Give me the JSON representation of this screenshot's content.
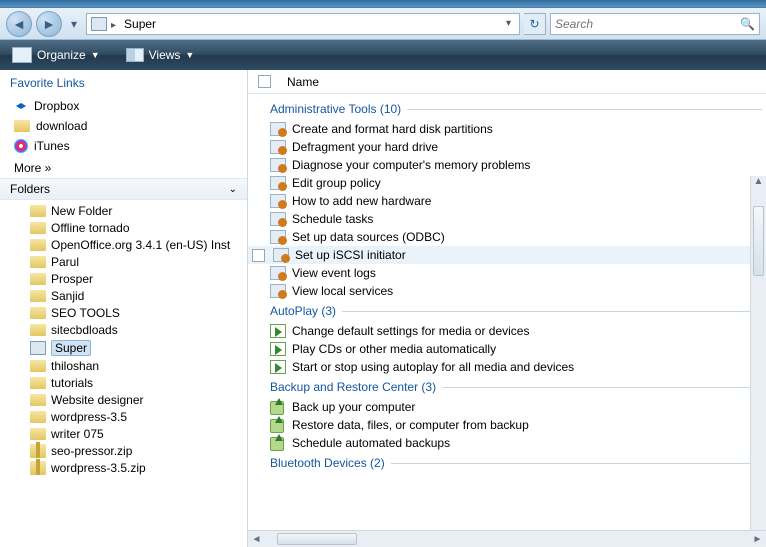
{
  "address": {
    "current": "Super"
  },
  "search": {
    "placeholder": "Search"
  },
  "toolbar": {
    "organize": "Organize",
    "views": "Views"
  },
  "sidebar": {
    "favorites_header": "Favorite Links",
    "favorites": [
      {
        "label": "Dropbox",
        "icon": "dropbox"
      },
      {
        "label": "download",
        "icon": "folder"
      },
      {
        "label": "iTunes",
        "icon": "itunes"
      }
    ],
    "more": "More »",
    "folders_header": "Folders",
    "tree": [
      {
        "label": "New Folder",
        "icon": "folder"
      },
      {
        "label": "Offline tornado",
        "icon": "folder"
      },
      {
        "label": "OpenOffice.org 3.4.1 (en-US) Inst",
        "icon": "folder"
      },
      {
        "label": "Parul",
        "icon": "folder"
      },
      {
        "label": "Prosper",
        "icon": "folder"
      },
      {
        "label": "Sanjid",
        "icon": "folder"
      },
      {
        "label": "SEO TOOLS",
        "icon": "folder"
      },
      {
        "label": "sitecbdloads",
        "icon": "folder"
      },
      {
        "label": "Super",
        "icon": "super",
        "selected": true
      },
      {
        "label": "thiloshan",
        "icon": "folder"
      },
      {
        "label": "tutorials",
        "icon": "folder"
      },
      {
        "label": "Website designer",
        "icon": "folder"
      },
      {
        "label": "wordpress-3.5",
        "icon": "folder"
      },
      {
        "label": "writer 075",
        "icon": "folder"
      },
      {
        "label": "seo-pressor.zip",
        "icon": "zip"
      },
      {
        "label": "wordpress-3.5.zip",
        "icon": "zip"
      }
    ]
  },
  "columns": {
    "name": "Name"
  },
  "groups": [
    {
      "title": "Administrative Tools (10)",
      "icon": "admin",
      "items": [
        {
          "label": "Create and format hard disk partitions"
        },
        {
          "label": "Defragment your hard drive"
        },
        {
          "label": "Diagnose your computer's memory problems"
        },
        {
          "label": "Edit group policy"
        },
        {
          "label": "How to add new hardware"
        },
        {
          "label": "Schedule tasks"
        },
        {
          "label": "Set up data sources (ODBC)"
        },
        {
          "label": "Set up iSCSI initiator",
          "selected": true
        },
        {
          "label": "View event logs"
        },
        {
          "label": "View local services"
        }
      ]
    },
    {
      "title": "AutoPlay (3)",
      "icon": "play",
      "items": [
        {
          "label": "Change default settings for media or devices"
        },
        {
          "label": "Play CDs or other media automatically"
        },
        {
          "label": "Start or stop using autoplay for all media and devices"
        }
      ]
    },
    {
      "title": "Backup and Restore Center (3)",
      "icon": "backup",
      "items": [
        {
          "label": "Back up your computer"
        },
        {
          "label": "Restore data, files, or computer from backup"
        },
        {
          "label": "Schedule automated backups"
        }
      ]
    },
    {
      "title": "Bluetooth Devices (2)",
      "icon": "admin",
      "items": []
    }
  ]
}
